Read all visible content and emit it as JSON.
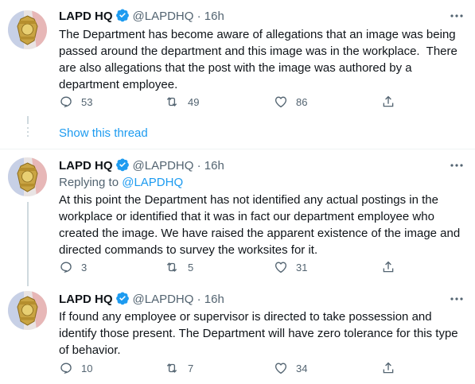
{
  "tweets": [
    {
      "name": "LAPD HQ",
      "handle": "@LAPDHQ",
      "dot": "·",
      "time": "16h",
      "text": "The Department has become aware of allegations that an image was being passed around the department and this image was in the workplace.  There are also allegations that the post with the image was authored by a department employee.",
      "replies": "53",
      "retweets": "49",
      "likes": "86"
    },
    {
      "name": "LAPD HQ",
      "handle": "@LAPDHQ",
      "dot": "·",
      "time": "16h",
      "replying_prefix": "Replying to ",
      "replying_handle": "@LAPDHQ",
      "text": "At this point the Department has not identified any actual postings in the workplace or identified that it was in fact our department employee who created the image. We have raised the apparent existence of the image and directed commands to survey the worksites for it.",
      "replies": "3",
      "retweets": "5",
      "likes": "31"
    },
    {
      "name": "LAPD HQ",
      "handle": "@LAPDHQ",
      "dot": "·",
      "time": "16h",
      "text": "If found any employee or supervisor is directed to take possession and identify those present. The Department will have zero tolerance for this type of behavior.",
      "replies": "10",
      "retweets": "7",
      "likes": "34"
    }
  ],
  "show_thread_label": "Show this thread",
  "icons": [
    "verified-badge-icon",
    "more-options-icon",
    "reply-icon",
    "retweet-icon",
    "like-icon",
    "share-icon"
  ],
  "colors": {
    "accent": "#1d9bf0",
    "secondary_text": "#536471",
    "primary_text": "#0f1419"
  }
}
